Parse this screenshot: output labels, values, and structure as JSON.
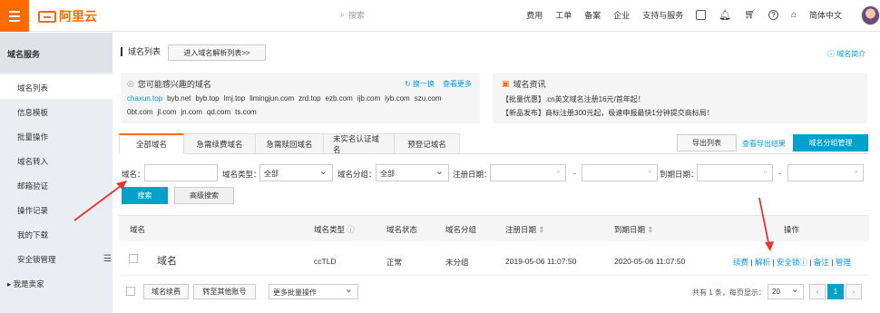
{
  "header": {
    "logo_text": "阿里云",
    "search_placeholder": "搜索",
    "nav": [
      "费用",
      "工单",
      "备案",
      "企业",
      "支持与服务"
    ],
    "language": "简体中文"
  },
  "sidebar": {
    "title": "域名服务",
    "items": [
      {
        "label": "域名列表",
        "active": true
      },
      {
        "label": "信息模板"
      },
      {
        "label": "批量操作"
      },
      {
        "label": "域名转入"
      },
      {
        "label": "邮箱验证"
      },
      {
        "label": "操作记录"
      },
      {
        "label": "我的下载"
      },
      {
        "label": "安全锁管理"
      },
      {
        "label": "我是卖家"
      }
    ]
  },
  "page": {
    "title": "域名列表",
    "resolve_button": "进入域名解析列表>>",
    "intro_link": "域名简介"
  },
  "interest_panel": {
    "title": "您可能感兴趣的域名",
    "refresh": "换一换",
    "more": "查看更多",
    "line1": [
      "chaxun.top",
      "byb.net",
      "byb.top",
      "lmj.top",
      "limingjun.com",
      "zrd.top",
      "ezb.com",
      "ijb.com",
      "iyb.com",
      "szu.com"
    ],
    "line2": [
      "0bt.com",
      "jl.com",
      "jn.com",
      "qd.com",
      "ts.com"
    ]
  },
  "news_panel": {
    "title": "域名资讯",
    "items": [
      "【批量优惠】.cn英文域名注册16元/首年起！",
      "【新品发布】商标注册300元起，极速申报最快1分钟提交商标局！"
    ]
  },
  "tabs": [
    "全部域名",
    "急需续费域名",
    "急需赎回域名",
    "未实名认证域名",
    "预登记域名"
  ],
  "toolbar": {
    "export": "导出列表",
    "export_result": "查看导出结果",
    "group_manage": "域名分组管理"
  },
  "filters": {
    "name_label": "域名：",
    "type_label": "域名类型：",
    "type_value": "全部",
    "group_label": "域名分组：",
    "group_value": "全部",
    "reg_date_label": "注册日期：",
    "exp_date_label": "到期日期：",
    "dash": "-",
    "search": "搜索",
    "advanced": "高级搜索"
  },
  "table": {
    "columns": [
      "域名",
      "域名类型",
      "域名状态",
      "域名分组",
      "注册日期",
      "到期日期",
      "操作"
    ],
    "rows": [
      {
        "domain": "域名",
        "type": "ccTLD",
        "status": "正常",
        "group": "未分组",
        "reg_date": "2019-05-06 11:07:50",
        "exp_date": "2020-05-06 11:07:50",
        "ops": [
          "续费",
          "解析",
          "安全锁",
          "备注",
          "管理"
        ]
      }
    ]
  },
  "footer": {
    "renew": "域名续费",
    "transfer": "转至其他账号",
    "more_ops": "更多批量操作",
    "page_info": "共有 1 条，每页显示：",
    "page_size": "20",
    "current_page": "1",
    "prev": "‹",
    "next": "›"
  },
  "colors": {
    "brand_orange": "#ff6a00",
    "primary_blue": "#00a2ca",
    "link_blue": "#0099e5",
    "annotation_red": "#e8322b"
  }
}
